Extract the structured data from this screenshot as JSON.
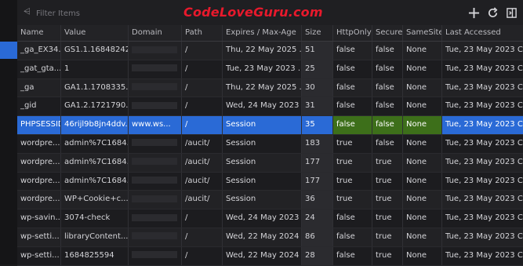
{
  "toolbar": {
    "filter_placeholder": "Filter Items",
    "watermark": "CodeLoveGuru.com"
  },
  "columns": [
    "Name",
    "Value",
    "Domain",
    "Path",
    "Expires / Max-Age",
    "Size",
    "HttpOnly",
    "Secure",
    "SameSite",
    "Last Accessed"
  ],
  "rows": [
    {
      "name": "_ga_EX34...",
      "value": "GS1.1.16848242...",
      "domain": "",
      "path": "/",
      "expires": "Thu, 22 May 2025 ...",
      "size": "51",
      "httponly": "false",
      "secure": "false",
      "samesite": "None",
      "last": "Tue, 23 May 2023 C..."
    },
    {
      "name": "_gat_gta...",
      "value": "1",
      "domain": "",
      "path": "/",
      "expires": "Tue, 23 May 2023 ...",
      "size": "25",
      "httponly": "false",
      "secure": "false",
      "samesite": "None",
      "last": "Tue, 23 May 2023 C..."
    },
    {
      "name": "_ga",
      "value": "GA1.1.1708335...",
      "domain": "",
      "path": "/",
      "expires": "Thu, 22 May 2025 ...",
      "size": "30",
      "httponly": "false",
      "secure": "false",
      "samesite": "None",
      "last": "Tue, 23 May 2023 C..."
    },
    {
      "name": "_gid",
      "value": "GA1.2.1721790...",
      "domain": "",
      "path": "/",
      "expires": "Wed, 24 May 2023 ...",
      "size": "31",
      "httponly": "false",
      "secure": "false",
      "samesite": "None",
      "last": "Tue, 23 May 2023 C..."
    },
    {
      "name": "PHPSESSID",
      "value": "46rijl9b8jn4ddv...",
      "domain": "www.ws...",
      "path": "/",
      "expires": "Session",
      "size": "35",
      "httponly": "false",
      "secure": "false",
      "samesite": "None",
      "last": "Tue, 23 May 2023 C...",
      "selected": true
    },
    {
      "name": "wordpre...",
      "value": "admin%7C1684...",
      "domain": "",
      "path": "/aucit/",
      "expires": "Session",
      "size": "183",
      "httponly": "true",
      "secure": "false",
      "samesite": "None",
      "last": "Tue, 23 May 2023 C..."
    },
    {
      "name": "wordpre...",
      "value": "admin%7C1684...",
      "domain": "",
      "path": "/aucit/",
      "expires": "Session",
      "size": "177",
      "httponly": "true",
      "secure": "true",
      "samesite": "None",
      "last": "Tue, 23 May 2023 C..."
    },
    {
      "name": "wordpre...",
      "value": "admin%7C1684...",
      "domain": "",
      "path": "/aucit/",
      "expires": "Session",
      "size": "177",
      "httponly": "true",
      "secure": "true",
      "samesite": "None",
      "last": "Tue, 23 May 2023 C..."
    },
    {
      "name": "wordpre...",
      "value": "WP+Cookie+c...",
      "domain": "",
      "path": "/aucit/",
      "expires": "Session",
      "size": "36",
      "httponly": "true",
      "secure": "true",
      "samesite": "None",
      "last": "Tue, 23 May 2023 C..."
    },
    {
      "name": "wp-savin...",
      "value": "3074-check",
      "domain": "",
      "path": "/",
      "expires": "Wed, 24 May 2023 ...",
      "size": "24",
      "httponly": "false",
      "secure": "true",
      "samesite": "None",
      "last": "Tue, 23 May 2023 C..."
    },
    {
      "name": "wp-setti...",
      "value": "libraryContent...",
      "domain": "",
      "path": "/",
      "expires": "Wed, 22 May 2024 ...",
      "size": "86",
      "httponly": "false",
      "secure": "true",
      "samesite": "None",
      "last": "Tue, 23 May 2023 C..."
    },
    {
      "name": "wp-setti...",
      "value": "1684825594",
      "domain": "",
      "path": "/",
      "expires": "Wed, 22 May 2024 ...",
      "size": "28",
      "httponly": "false",
      "secure": "true",
      "samesite": "None",
      "last": "Tue, 23 May 2023 C..."
    }
  ]
}
